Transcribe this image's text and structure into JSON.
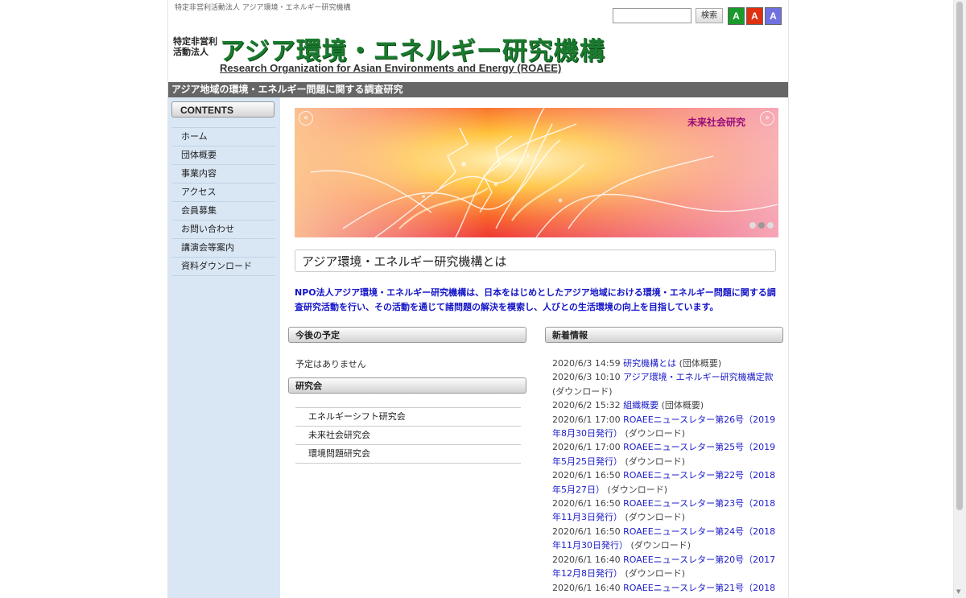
{
  "header": {
    "tagline": "特定非営利活動法人 アジア環境・エネルギー研究機構",
    "search_button": "検索",
    "font_buttons": [
      {
        "label": "A",
        "color": "#1a9a2a"
      },
      {
        "label": "A",
        "color": "#e03010"
      },
      {
        "label": "A",
        "color": "#7070e0"
      }
    ],
    "logo_small_line1": "特定非営利",
    "logo_small_line2": "活動法人",
    "logo_title": "アジア環境・エネルギー研究機構",
    "logo_english": "Research Organization for Asian Environments and Energy (ROAEE)",
    "subtitle": "アジア地域の環境・エネルギー問題に関する調査研究"
  },
  "sidebar": {
    "heading": "CONTENTS",
    "items": [
      {
        "label": "ホーム"
      },
      {
        "label": "団体概要"
      },
      {
        "label": "事業内容"
      },
      {
        "label": "アクセス"
      },
      {
        "label": "会員募集"
      },
      {
        "label": "お問い合わせ"
      },
      {
        "label": "講演会等案内"
      },
      {
        "label": "資料ダウンロード"
      }
    ]
  },
  "slider": {
    "title": "未来社会研究",
    "prev": "«",
    "next": "»",
    "active_dot": 2,
    "dot_count": 3
  },
  "about": {
    "heading": "アジア環境・エネルギー研究機構とは",
    "text": "NPO法人アジア環境・エネルギー研究機構は、日本をはじめとしたアジア地域における環境・エネルギー問題に関する調査研究活動を行い、その活動を通じて諸問題の解決を模索し、人びとの生活環境の向上を目指しています。"
  },
  "schedule": {
    "heading": "今後の予定",
    "empty_text": "予定はありません"
  },
  "research": {
    "heading": "研究会",
    "items": [
      {
        "label": "エネルギーシフト研究会"
      },
      {
        "label": "未来社会研究会"
      },
      {
        "label": "環境問題研究会"
      }
    ]
  },
  "news": {
    "heading": "新着情報",
    "items": [
      {
        "date": "2020/6/3 14:59",
        "title": "研究機構とは",
        "category": "(団体概要)"
      },
      {
        "date": "2020/6/3 10:10",
        "title": "アジア環境・エネルギー研究機構定款",
        "category": "(ダウンロード)"
      },
      {
        "date": "2020/6/2 15:32",
        "title": "組織概要",
        "category": "(団体概要)"
      },
      {
        "date": "2020/6/1 17:00",
        "title": "ROAEEニュースレター第26号（2019年8月30日発行）",
        "category": "(ダウンロード)"
      },
      {
        "date": "2020/6/1 17:00",
        "title": "ROAEEニュースレター第25号（2019年5月25日発行）",
        "category": "(ダウンロード)"
      },
      {
        "date": "2020/6/1 16:50",
        "title": "ROAEEニュースレター第22号（2018年5月27日）",
        "category": "(ダウンロード)"
      },
      {
        "date": "2020/6/1 16:50",
        "title": "ROAEEニュースレター第23号（2018年11月3日発行）",
        "category": "(ダウンロード)"
      },
      {
        "date": "2020/6/1 16:50",
        "title": "ROAEEニュースレター第24号（2018年11月30日発行）",
        "category": "(ダウンロード)"
      },
      {
        "date": "2020/6/1 16:40",
        "title": "ROAEEニュースレター第20号（2017年12月8日発行）",
        "category": "(ダウンロード)"
      },
      {
        "date": "2020/6/1 16:40",
        "title": "ROAEEニュースレター第21号（2018",
        "category": ""
      }
    ]
  }
}
